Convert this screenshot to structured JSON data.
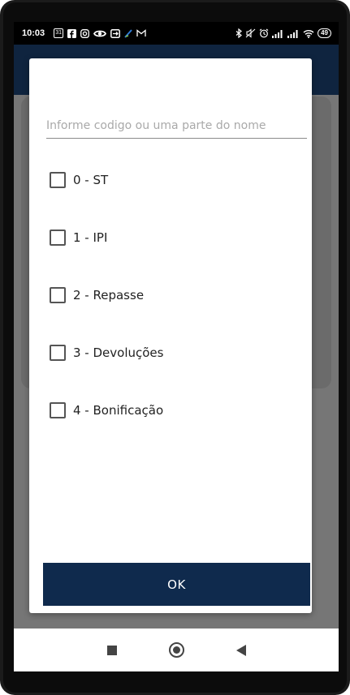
{
  "status_bar": {
    "time": "10:03",
    "left_icons": [
      "calendar-icon",
      "facebook-icon",
      "instagram-icon",
      "eye-icon",
      "screen-mirror-icon",
      "shade-icon",
      "gmail-icon"
    ],
    "calendar_text": "31",
    "right_icons": [
      "bluetooth-icon",
      "mute-icon",
      "alarm-icon",
      "signal-icon",
      "signal-icon",
      "wifi-icon"
    ],
    "battery": "49"
  },
  "dialog": {
    "search": {
      "placeholder": "Informe codigo ou uma parte do nome",
      "value": ""
    },
    "options": [
      {
        "label": "0 - ST",
        "checked": false
      },
      {
        "label": "1 - IPI",
        "checked": false
      },
      {
        "label": "2 - Repasse",
        "checked": false
      },
      {
        "label": "3 - Devoluções",
        "checked": false
      },
      {
        "label": "4 - Bonificação",
        "checked": false
      }
    ],
    "ok_label": "OK"
  },
  "nav_bar": {
    "icons": [
      "recents-icon",
      "home-icon",
      "back-icon"
    ]
  },
  "colors": {
    "app_bar": "#0f243f",
    "ok_button": "#0f2a4d"
  }
}
